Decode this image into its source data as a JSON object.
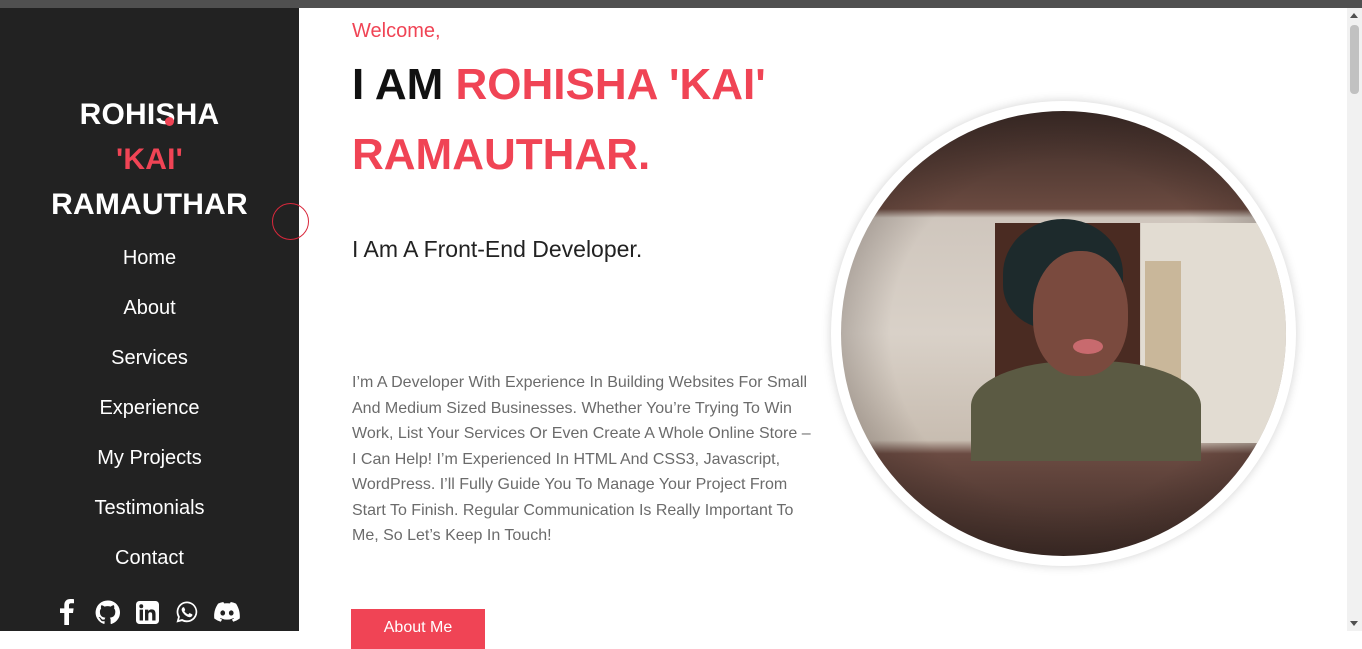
{
  "sidebar": {
    "brand": {
      "line1": "ROHISHA",
      "line2": "'KAI'",
      "line3": "RAMAUTHAR"
    },
    "nav": [
      {
        "label": "Home"
      },
      {
        "label": "About"
      },
      {
        "label": "Services"
      },
      {
        "label": "Experience"
      },
      {
        "label": "My Projects"
      },
      {
        "label": "Testimonials"
      },
      {
        "label": "Contact"
      }
    ],
    "social_icons": [
      "facebook-icon",
      "github-icon",
      "linkedin-icon",
      "whatsapp-icon",
      "discord-icon"
    ]
  },
  "hero": {
    "welcome": "Welcome,",
    "headline_prefix": "I AM",
    "headline_name": "ROHISHA 'KAI' RAMAUTHAR.",
    "subtitle": "I Am A Front-End Developer.",
    "bio": "I’m A Developer With Experience In Building Websites For Small And Medium Sized Businesses. Whether You’re Trying To Win Work, List Your Services Or Even Create A Whole Online Store – I Can Help! I’m Experienced In HTML And CSS3, Javascript, WordPress. I’ll Fully Guide You To Manage Your Project From Start To Finish. Regular Communication Is Really Important To Me, So Let’s Keep In Touch!",
    "cta_label": "About Me"
  },
  "colors": {
    "accent": "#f04455",
    "sidebar_bg": "#222222",
    "text_dark": "#111111",
    "text_muted": "#6b6b6b"
  }
}
